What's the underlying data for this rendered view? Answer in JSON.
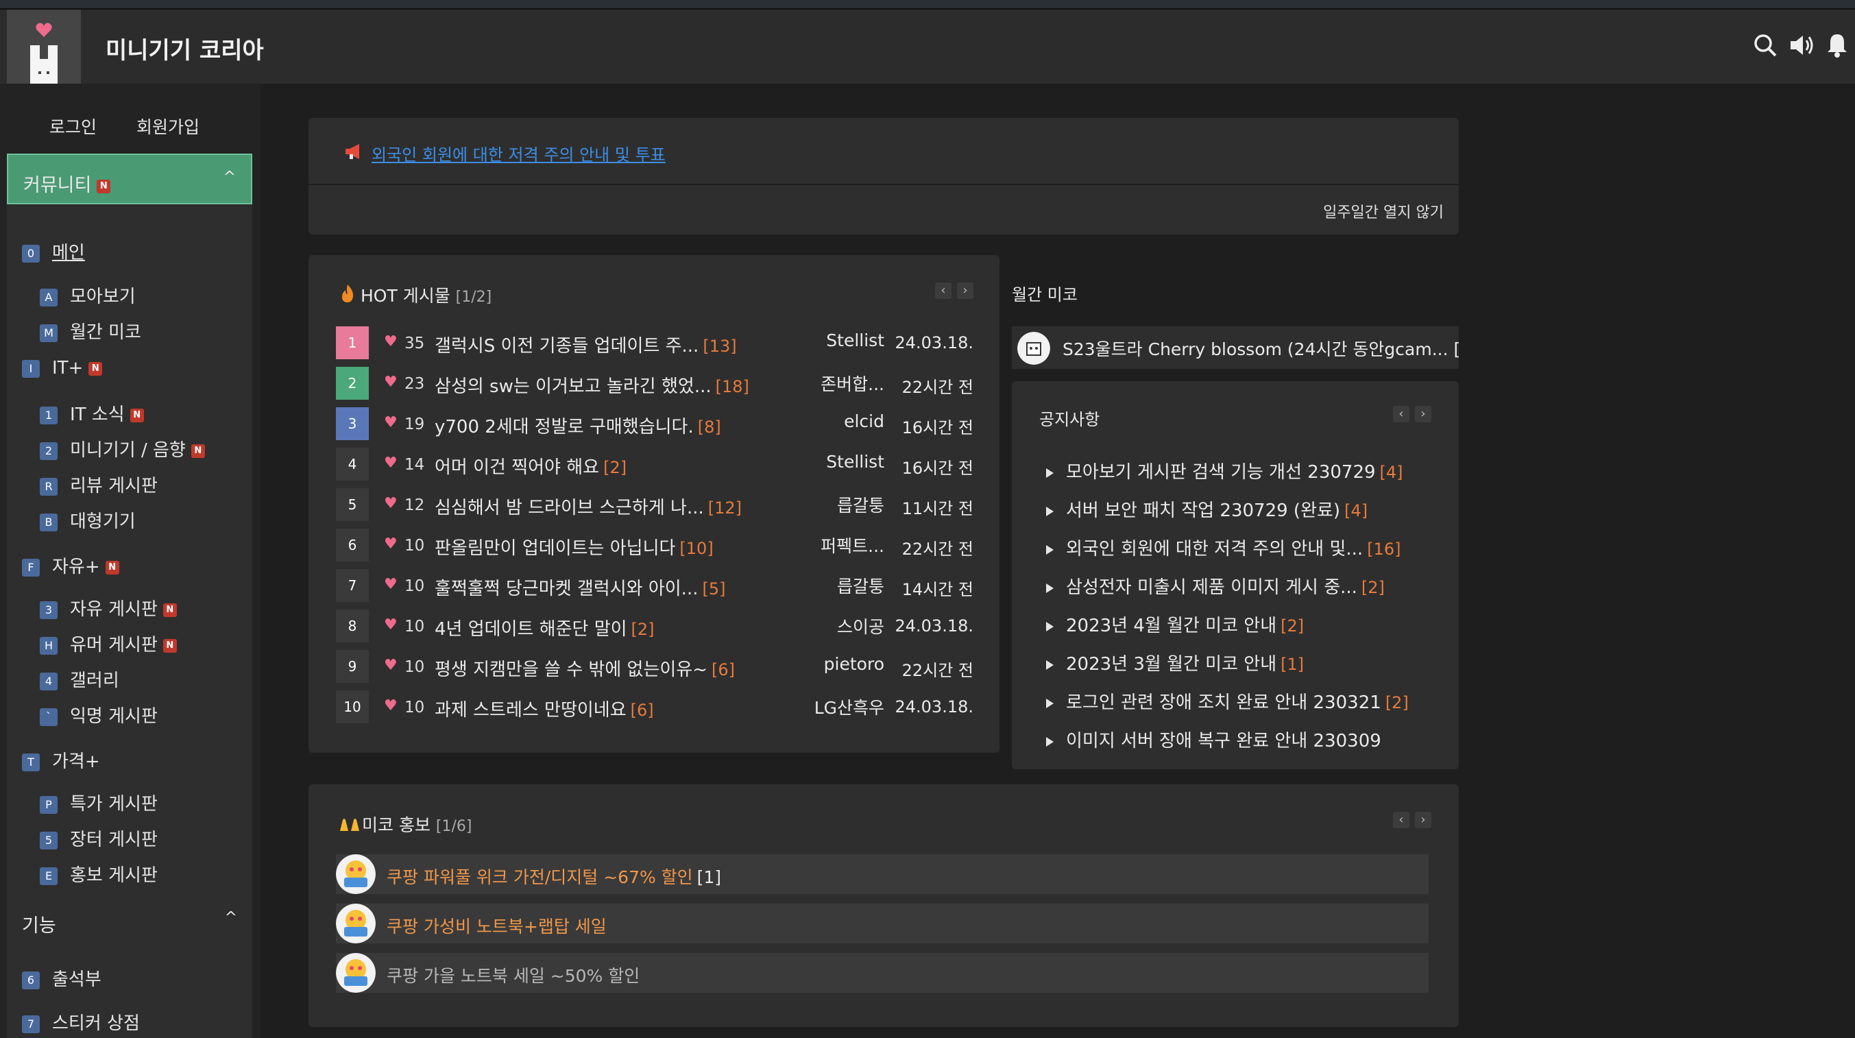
{
  "header": {
    "title": "미니기기 코리아"
  },
  "auth": {
    "login": "로그인",
    "signup": "회원가입"
  },
  "sidebar": {
    "community": {
      "label": "커뮤니티",
      "new": "N"
    },
    "main": {
      "key": "0",
      "label": "메인"
    },
    "items": [
      {
        "key": "A",
        "label": "모아보기",
        "new": ""
      },
      {
        "key": "M",
        "label": "월간 미코",
        "new": ""
      },
      {
        "key": "I",
        "label": "IT+",
        "new": "N"
      },
      {
        "key": "1",
        "label": "IT 소식",
        "new": "N"
      },
      {
        "key": "2",
        "label": "미니기기 / 음향",
        "new": "N"
      },
      {
        "key": "R",
        "label": "리뷰 게시판",
        "new": ""
      },
      {
        "key": "B",
        "label": "대형기기",
        "new": ""
      },
      {
        "key": "F",
        "label": "자유+",
        "new": "N"
      },
      {
        "key": "3",
        "label": "자유 게시판",
        "new": "N"
      },
      {
        "key": "H",
        "label": "유머 게시판",
        "new": "N"
      },
      {
        "key": "4",
        "label": "갤러리",
        "new": ""
      },
      {
        "key": "`",
        "label": "익명 게시판",
        "new": ""
      },
      {
        "key": "T",
        "label": "가격+",
        "new": ""
      },
      {
        "key": "P",
        "label": "특가 게시판",
        "new": ""
      },
      {
        "key": "5",
        "label": "장터 게시판",
        "new": ""
      },
      {
        "key": "E",
        "label": "홍보 게시판",
        "new": ""
      }
    ],
    "features": {
      "label": "기능"
    },
    "feature_items": [
      {
        "key": "6",
        "label": "출석부"
      },
      {
        "key": "7",
        "label": "스티커 상점"
      }
    ]
  },
  "notice_bar": {
    "link": "외국인 회원에 대한 저격 주의 안내 및 투표",
    "close": "일주일간 열지 않기"
  },
  "hot": {
    "title": "HOT 게시물",
    "page": "[1/2]",
    "rows": [
      {
        "rank": "1",
        "likes": "35",
        "title": "갤럭시S 이전 기종들 업데이트 주...",
        "count": "[13]",
        "author": "Stellist",
        "date": "24.03.18.",
        "color": "#e87a9a"
      },
      {
        "rank": "2",
        "likes": "23",
        "title": "삼성의 sw는 이거보고 놀라긴 했었...",
        "count": "[18]",
        "author": "존버합...",
        "date": "22시간 전",
        "color": "#4aa87a"
      },
      {
        "rank": "3",
        "likes": "19",
        "title": "y700 2세대 정발로 구매했습니다.",
        "count": "[8]",
        "author": "elcid",
        "date": "16시간 전",
        "color": "#5a78b8"
      },
      {
        "rank": "4",
        "likes": "14",
        "title": "어머 이건 찍어야 해요",
        "count": "[2]",
        "author": "Stellist",
        "date": "16시간 전",
        "color": "#3a3a3a"
      },
      {
        "rank": "5",
        "likes": "12",
        "title": "심심해서 밤 드라이브 스근하게 나...",
        "count": "[12]",
        "author": "릅갈퉁",
        "date": "11시간 전",
        "color": "#3a3a3a"
      },
      {
        "rank": "6",
        "likes": "10",
        "title": "판올림만이 업데이트는 아닙니다",
        "count": "[10]",
        "author": "퍼펙트...",
        "date": "22시간 전",
        "color": "#3a3a3a"
      },
      {
        "rank": "7",
        "likes": "10",
        "title": "훌쩍훌쩍 당근마켓 갤럭시와 아이...",
        "count": "[5]",
        "author": "릅갈퉁",
        "date": "14시간 전",
        "color": "#3a3a3a"
      },
      {
        "rank": "8",
        "likes": "10",
        "title": "4년 업데이트 해준단 말이",
        "count": "[2]",
        "author": "스이공",
        "date": "24.03.18.",
        "color": "#3a3a3a"
      },
      {
        "rank": "9",
        "likes": "10",
        "title": "평생 지캠만을 쓸 수 밖에 없는이유~",
        "count": "[6]",
        "author": "pietoro",
        "date": "22시간 전",
        "color": "#3a3a3a"
      },
      {
        "rank": "10",
        "likes": "10",
        "title": "과제 스트레스 만땅이네요",
        "count": "[6]",
        "author": "LG산흑우",
        "date": "24.03.18.",
        "color": "#3a3a3a"
      }
    ]
  },
  "monthly": {
    "title": "월간 미코",
    "item": "S23울트라 Cherry blossom (24시간 동안gcam... ["
  },
  "notices": {
    "title": "공지사항",
    "items": [
      {
        "title": "모아보기 게시판 검색 기능 개선 230729",
        "count": "[4]"
      },
      {
        "title": "서버 보안 패치 작업 230729 (완료)",
        "count": "[4]"
      },
      {
        "title": "외국인 회원에 대한 저격 주의 안내 및...",
        "count": "[16]"
      },
      {
        "title": "삼성전자 미출시 제품 이미지 게시 중...",
        "count": "[2]"
      },
      {
        "title": "2023년 4월 월간 미코 안내",
        "count": "[2]"
      },
      {
        "title": "2023년 3월 월간 미코 안내",
        "count": "[1]"
      },
      {
        "title": "로그인 관련 장애 조치 완료 안내 230321",
        "count": "[2]"
      },
      {
        "title": "이미지 서버 장애 복구 완료 안내 230309",
        "count": ""
      }
    ]
  },
  "promo": {
    "title": "미코 홍보",
    "page": "[1/6]",
    "items": [
      {
        "title": "쿠팡 파워풀 위크 가전/디지털 ~67% 할인",
        "count": "[1]"
      },
      {
        "title": "쿠팡 가성비 노트북+랩탑 세일",
        "count": ""
      },
      {
        "title": "쿠팡 가을 노트북 세일 ~50% 할인",
        "count": ""
      }
    ]
  },
  "colors": {
    "accent": "#4a9a74",
    "link": "#3d8ee8",
    "count": "#e87a3b",
    "heart": "#ee6b8c",
    "key": "#4a6a9c",
    "badge": "#c0392b"
  },
  "icons": [
    "search-icon",
    "speaker-icon",
    "bell-icon",
    "chevron-up-icon",
    "megaphone-icon",
    "fire-icon",
    "heart-icon",
    "triangle-right-icon",
    "hands-icon"
  ]
}
